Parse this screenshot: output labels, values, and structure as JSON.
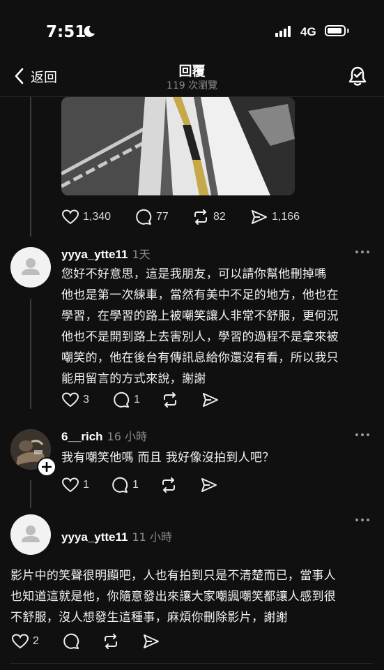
{
  "status_bar": {
    "time": "7:51",
    "network": "4G"
  },
  "header": {
    "back_label": "返回",
    "title": "回覆",
    "views": "119 次瀏覽"
  },
  "post_actions": {
    "likes": "1,340",
    "comments": "77",
    "reposts": "82",
    "shares": "1,166"
  },
  "replies": [
    {
      "username": "yyya_ytte11",
      "time": "1天",
      "lines": [
        "您好不好意思，這是我朋友，可以請你幫他刪掉嗎",
        "他也是第一次練車，當然有美中不足的地方，他也在",
        "學習，在學習的路上被嘲笑讓人非常不舒服，更何況",
        "他也不是開到路上去害別人，學習的過程不是拿來被",
        "嘲笑的，他在後台有傳訊息給你還沒有看，所以我只",
        "能用留言的方式來說，謝謝"
      ],
      "likes": "3",
      "comments": "1"
    },
    {
      "username": "6__rich",
      "time": "16 小時",
      "lines": [
        "我有嘲笑他嗎 而且 我好像沒拍到人吧？"
      ],
      "likes": "1",
      "comments": "1"
    },
    {
      "username": "yyya_ytte11",
      "time": "11 小時",
      "lines": [
        "影片中的笑聲很明顯吧，人也有拍到只是不清楚而已，當事人",
        "也知道這就是他，你隨意發出來讓大家嘲諷嘲笑都讓人感到很",
        "不舒服，沒人想發生這種事，麻煩你刪除影片，謝謝"
      ],
      "likes": "2"
    }
  ]
}
